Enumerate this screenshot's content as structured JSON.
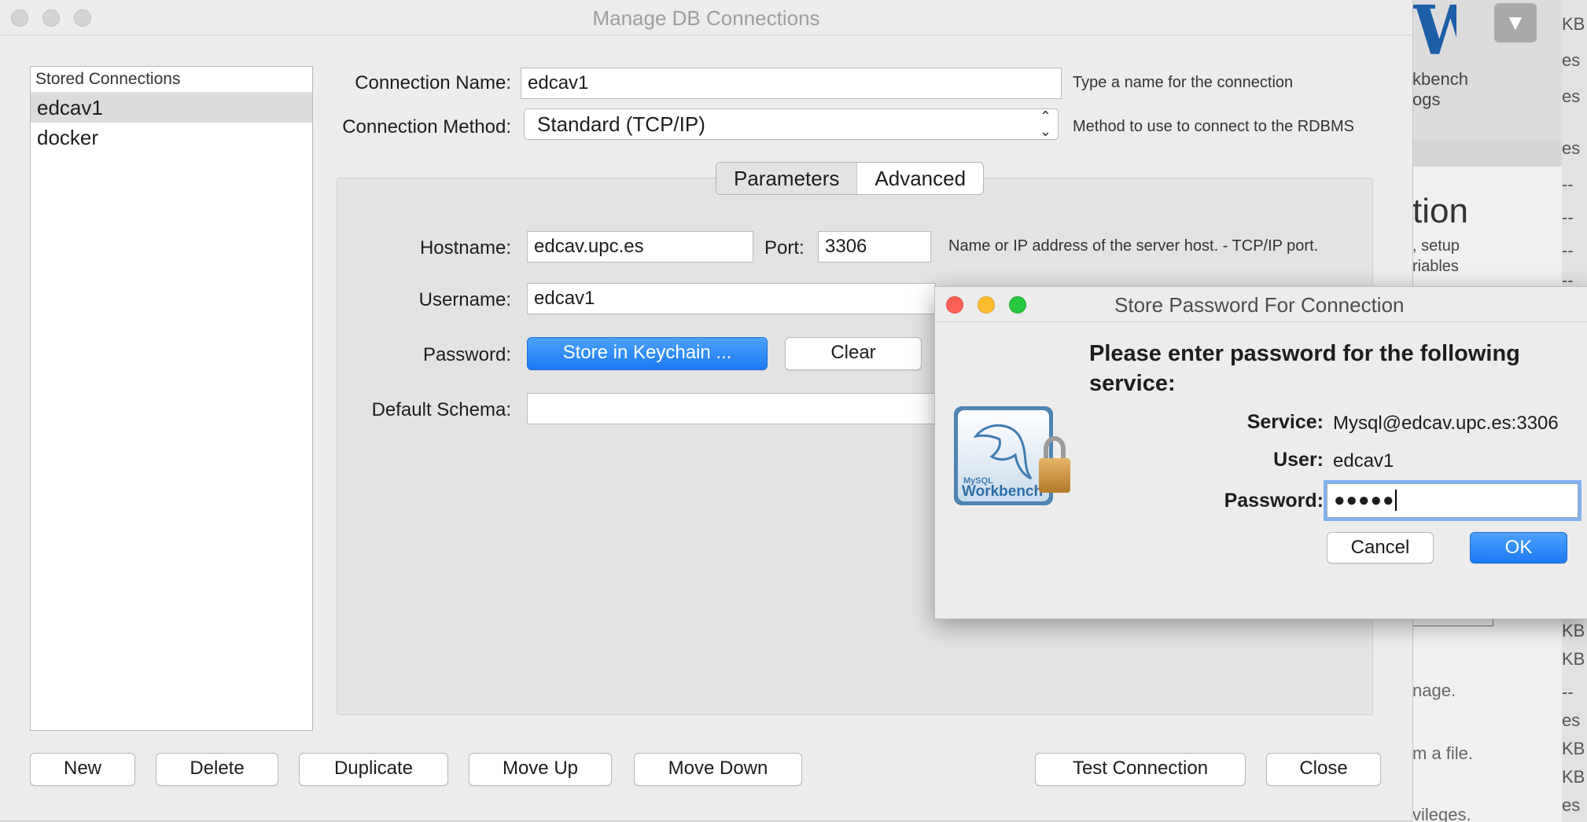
{
  "window": {
    "title": "Manage DB Connections"
  },
  "stored_connections": {
    "header": "Stored Connections",
    "items": [
      "edcav1",
      "docker"
    ],
    "selected": "edcav1"
  },
  "form": {
    "connection_name_label": "Connection Name:",
    "connection_name_value": "edcav1",
    "connection_name_hint": "Type a name for the connection",
    "connection_method_label": "Connection Method:",
    "connection_method_value": "Standard (TCP/IP)",
    "connection_method_hint": "Method to use to connect to the RDBMS"
  },
  "tabs": [
    "Parameters",
    "Advanced"
  ],
  "parameters": {
    "hostname_label": "Hostname:",
    "hostname_value": "edcav.upc.es",
    "port_label": "Port:",
    "port_value": "3306",
    "hostname_hint": "Name or IP address of the server host. - TCP/IP port.",
    "username_label": "Username:",
    "username_value": "edcav1",
    "password_label": "Password:",
    "store_keychain_label": "Store in Keychain ...",
    "clear_label": "Clear",
    "default_schema_label": "Default Schema:",
    "default_schema_value": ""
  },
  "bottom_buttons": {
    "new": "New",
    "delete": "Delete",
    "duplicate": "Duplicate",
    "move_up": "Move Up",
    "move_down": "Move Down",
    "test_connection": "Test Connection",
    "close": "Close"
  },
  "password_dialog": {
    "title": "Store Password For Connection",
    "heading": "Please enter password for the following service:",
    "service_label": "Service:",
    "service_value": "Mysql@edcav.upc.es:3306",
    "user_label": "User:",
    "user_value": "edcav1",
    "password_label": "Password:",
    "password_masked": "●●●●●",
    "cancel_label": "Cancel",
    "ok_label": "OK",
    "icon_text": "Workbench",
    "icon_small_text": "MySQL"
  },
  "background_app": {
    "wp_logo": "W",
    "wp_text_line1": "kbench",
    "wp_text_line2": "ogs",
    "heading": "tion",
    "sub_line1": ", setup",
    "sub_line2": "riables",
    "text1": "nage.",
    "text2": "m a file.",
    "text3": "vileges.",
    "column": [
      "KB",
      "es",
      "es",
      "es",
      "--",
      "--",
      "--",
      "--",
      "--",
      "KB",
      "KB",
      "--",
      "es",
      "KB",
      "KB",
      "es"
    ]
  },
  "colors": {
    "accent_blue": "#1b79f2",
    "close_red": "#fc5f57",
    "minimize_yellow": "#fdbc2e",
    "zoom_green": "#28c840"
  }
}
